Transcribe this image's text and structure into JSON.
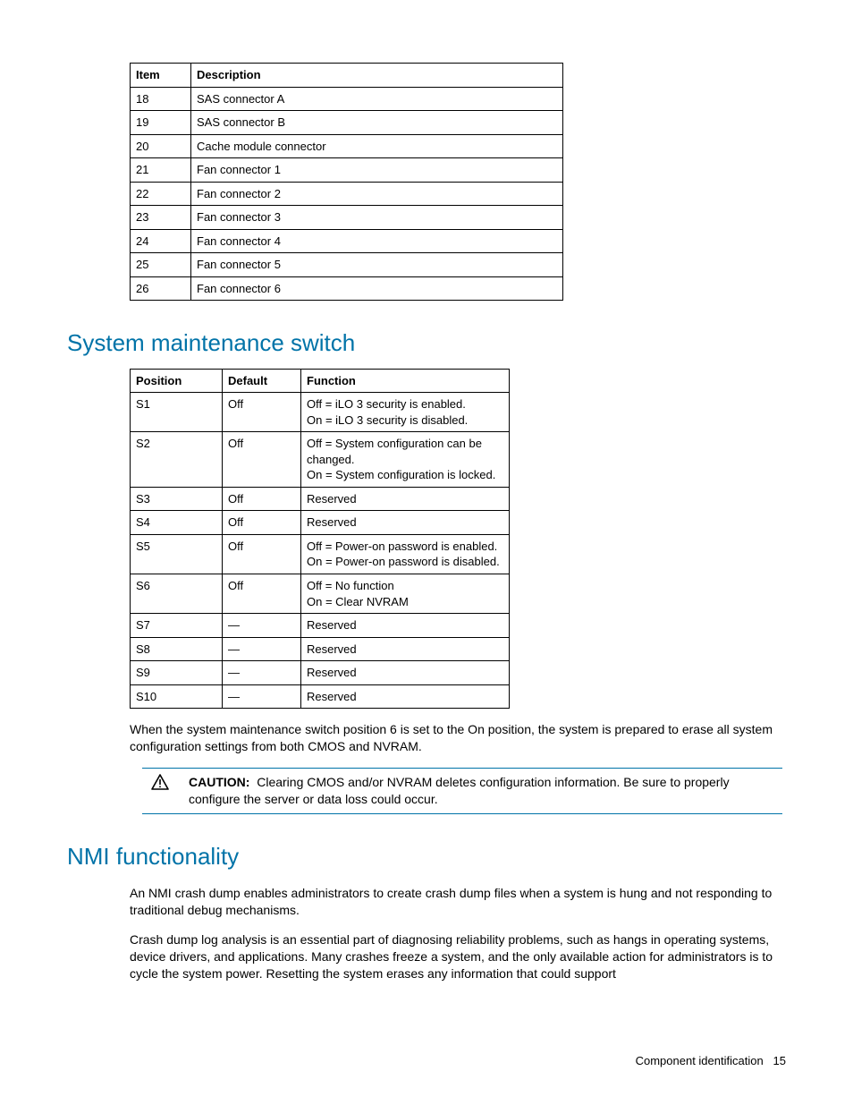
{
  "table1": {
    "headers": [
      "Item",
      "Description"
    ],
    "rows": [
      [
        "18",
        "SAS connector A"
      ],
      [
        "19",
        "SAS connector B"
      ],
      [
        "20",
        "Cache module connector"
      ],
      [
        "21",
        "Fan connector 1"
      ],
      [
        "22",
        "Fan connector 2"
      ],
      [
        "23",
        "Fan connector 3"
      ],
      [
        "24",
        "Fan connector 4"
      ],
      [
        "25",
        "Fan connector 5"
      ],
      [
        "26",
        "Fan connector 6"
      ]
    ]
  },
  "heading1": "System maintenance switch",
  "table2": {
    "headers": [
      "Position",
      "Default",
      "Function"
    ],
    "rows": [
      [
        "S1",
        "Off",
        "Off = iLO 3 security is enabled.\nOn = iLO 3 security is disabled."
      ],
      [
        "S2",
        "Off",
        "Off = System configuration can be changed.\nOn = System configuration is locked."
      ],
      [
        "S3",
        "Off",
        "Reserved"
      ],
      [
        "S4",
        "Off",
        "Reserved"
      ],
      [
        "S5",
        "Off",
        "Off = Power-on password is enabled.\nOn = Power-on password is disabled."
      ],
      [
        "S6",
        "Off",
        "Off = No function\nOn = Clear NVRAM"
      ],
      [
        "S7",
        "—",
        "Reserved"
      ],
      [
        "S8",
        "—",
        "Reserved"
      ],
      [
        "S9",
        "—",
        "Reserved"
      ],
      [
        "S10",
        "—",
        "Reserved"
      ]
    ]
  },
  "para1": "When the system maintenance switch position 6 is set to the On position, the system is prepared to erase all system configuration settings from both CMOS and NVRAM.",
  "caution_label": "CAUTION:",
  "caution_text": "Clearing CMOS and/or NVRAM deletes configuration information. Be sure to properly configure the server or data loss could occur.",
  "heading2": "NMI functionality",
  "para2": "An NMI crash dump enables administrators to create crash dump files when a system is hung and not responding to traditional debug mechanisms.",
  "para3": "Crash dump log analysis is an essential part of diagnosing reliability problems, such as hangs in operating systems, device drivers, and applications. Many crashes freeze a system, and the only available action for administrators is to cycle the system power. Resetting the system erases any information that could support",
  "footer_text": "Component identification",
  "footer_page": "15"
}
